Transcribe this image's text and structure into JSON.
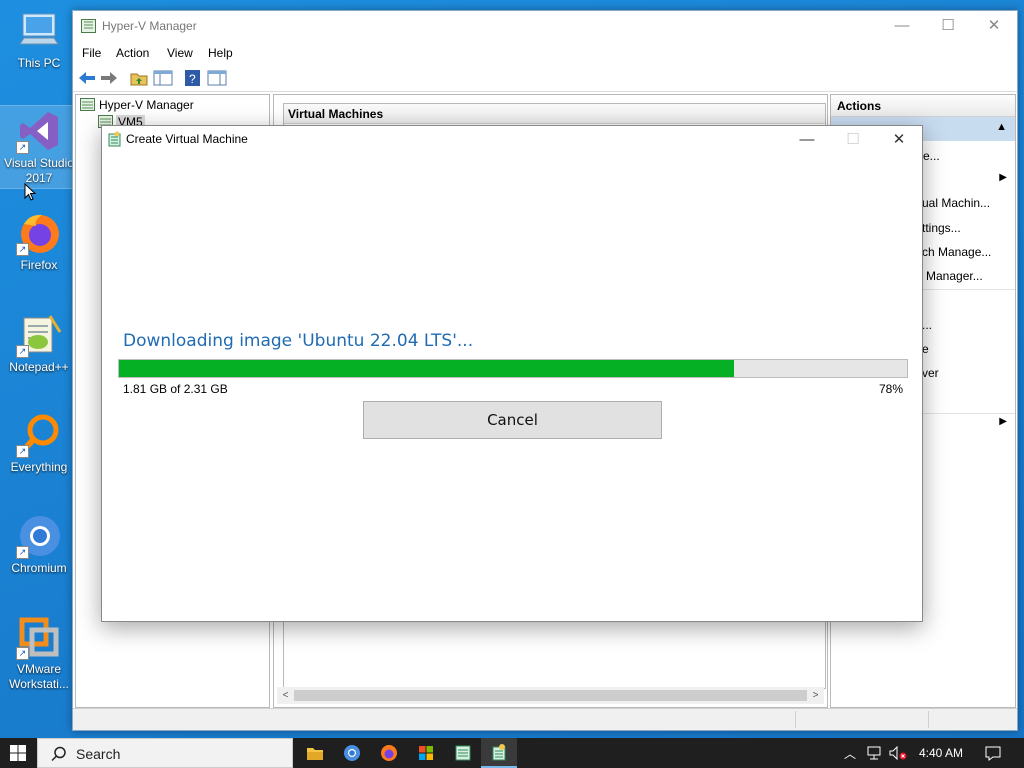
{
  "desktop": {
    "icons": [
      {
        "label": "This PC"
      },
      {
        "label": "Visual Studio 2017"
      },
      {
        "label": "Firefox"
      },
      {
        "label": "Notepad++"
      },
      {
        "label": "Everything"
      },
      {
        "label": "Chromium"
      },
      {
        "label": "VMware Workstati..."
      }
    ]
  },
  "hyperv": {
    "title": "Hyper-V Manager",
    "menu": [
      "File",
      "Action",
      "View",
      "Help"
    ],
    "tree": {
      "root": "Hyper-V Manager",
      "server": "VM5"
    },
    "center_title": "Virtual Machines",
    "actions": {
      "header": "Actions",
      "items": [
        "e...",
        "ual Machin...",
        "ttings...",
        "ch Manage...",
        "Manager...",
        "...",
        "e",
        "ver"
      ]
    }
  },
  "dialog": {
    "title": "Create Virtual Machine",
    "heading": "Downloading image 'Ubuntu 22.04 LTS'...",
    "progress_text": "1.81 GB of 2.31 GB",
    "progress_percent_label": "78%",
    "progress_fraction": 0.78,
    "cancel_label": "Cancel"
  },
  "taskbar": {
    "search_label": "Search",
    "clock": "4:40 AM"
  },
  "colors": {
    "desktop": "#1a7fd0",
    "progress_fill": "#06b025",
    "heading_blue": "#1f6bb4",
    "actions_highlight": "#c8dcf0"
  }
}
